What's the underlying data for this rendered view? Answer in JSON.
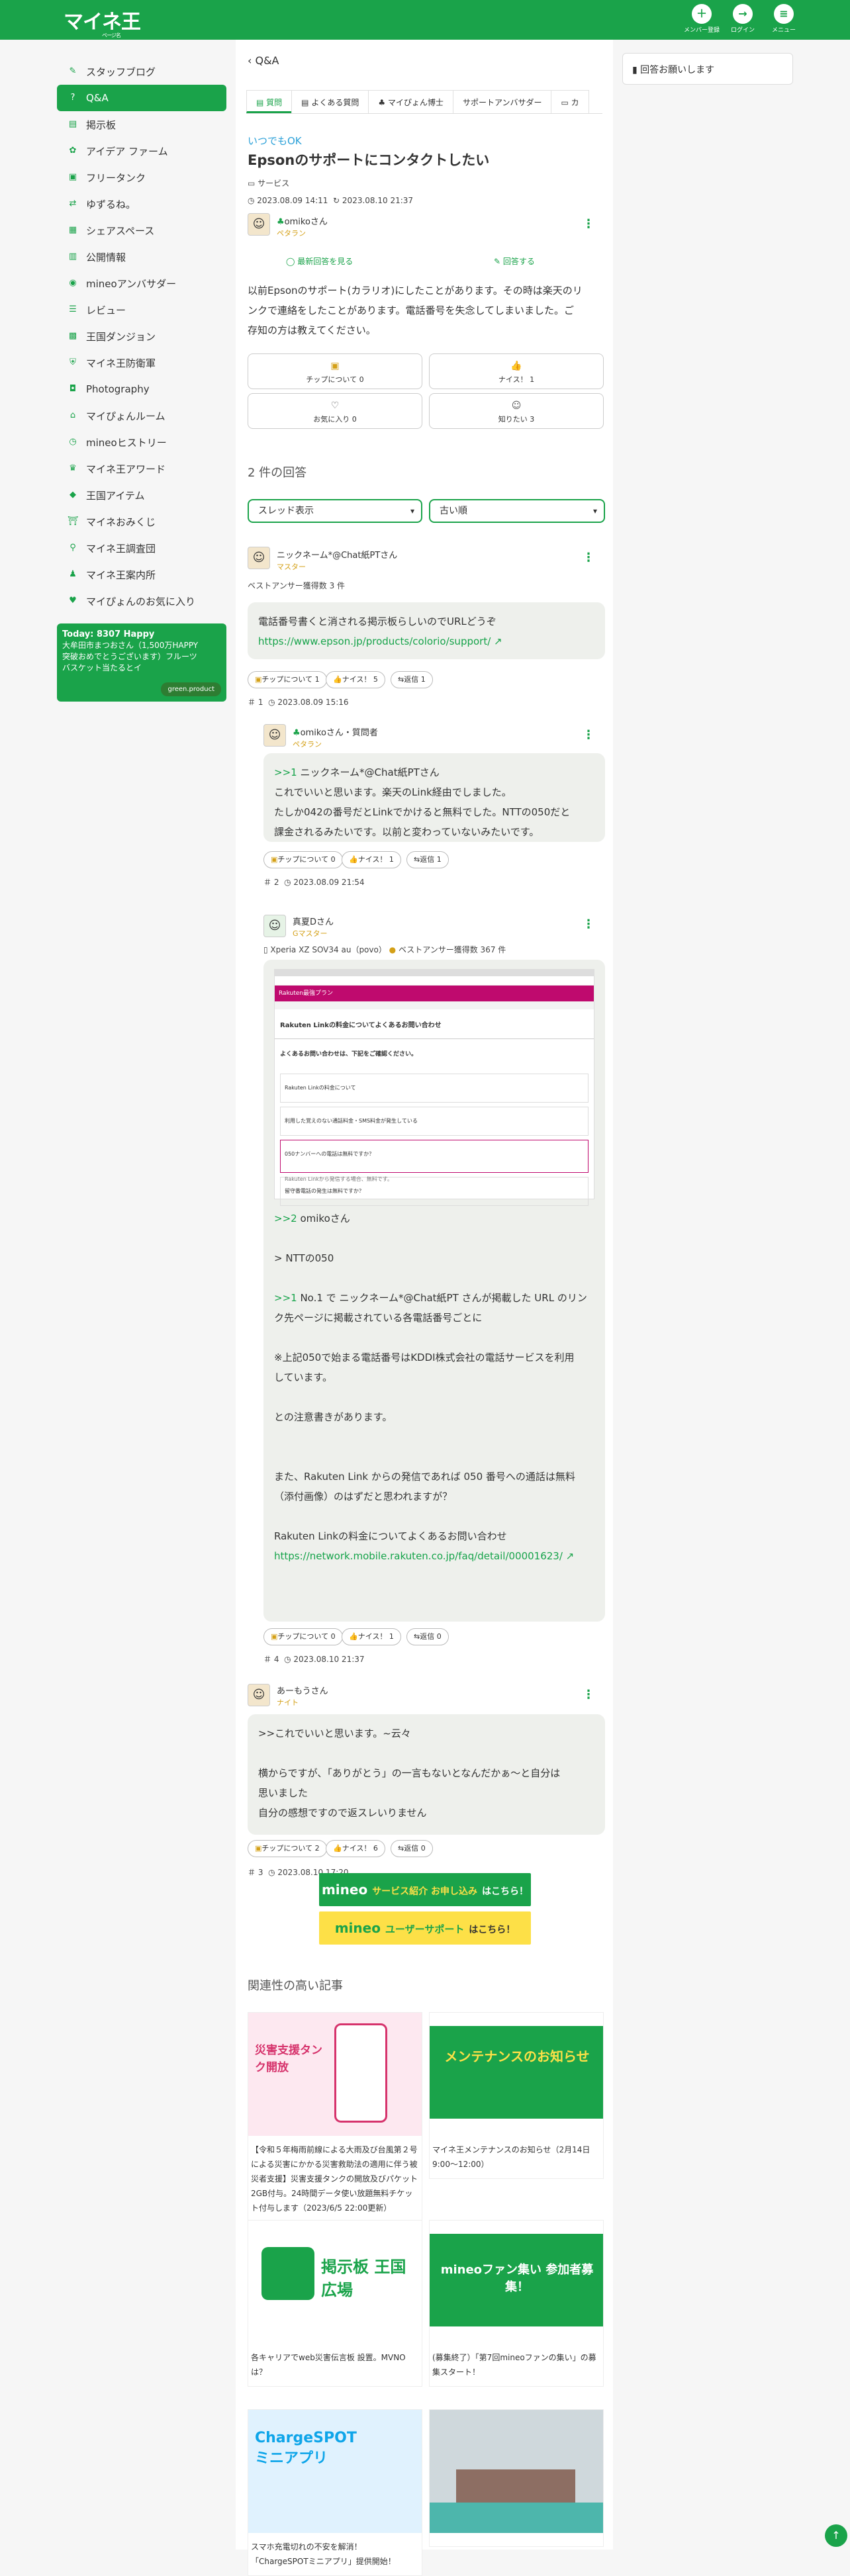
{
  "header": {
    "logo": "マイネ王",
    "logo_sub": "ページ名",
    "member_label": "メンバー登録",
    "login_label": "ログイン",
    "menu_label": "メニュー"
  },
  "sidebar": {
    "items": [
      {
        "label": "スタッフブログ",
        "icon": "blog-icon"
      },
      {
        "label": "Q&A",
        "icon": "qa-icon"
      },
      {
        "label": "掲示板",
        "icon": "board-icon"
      },
      {
        "label": "アイデア ファーム",
        "icon": "idea-icon"
      },
      {
        "label": "フリータンク",
        "icon": "tank-icon"
      },
      {
        "label": "ゆずるね。",
        "icon": "yuzurune-icon"
      },
      {
        "label": "シェアスペース",
        "icon": "share-icon"
      },
      {
        "label": "公開情報",
        "icon": "public-icon"
      },
      {
        "label": "mineoアンバサダー",
        "icon": "ambassador-icon"
      },
      {
        "label": "レビュー",
        "icon": "review-icon"
      },
      {
        "label": "王国ダンジョン",
        "icon": "dungeon-icon"
      },
      {
        "label": "マイネ王防衛軍",
        "icon": "defense-icon"
      },
      {
        "label": "Photography",
        "icon": "camera-icon"
      },
      {
        "label": "マイぴょんルーム",
        "icon": "room-icon"
      },
      {
        "label": "mineoヒストリー",
        "icon": "history-icon"
      },
      {
        "label": "マイネ王アワード",
        "icon": "award-icon"
      },
      {
        "label": "王国アイテム",
        "icon": "item-icon"
      },
      {
        "label": "マイネおみくじ",
        "icon": "omikuji-icon"
      },
      {
        "label": "マイネ王調査団",
        "icon": "survey-icon"
      },
      {
        "label": "マイネ王案内所",
        "icon": "guide-icon"
      },
      {
        "label": "マイぴょんのお気に入り",
        "icon": "favorite-icon"
      }
    ],
    "promo": {
      "title": "Today: 8307 Happy",
      "line1": "大牟田市まつおさん（1,500万HAPPY",
      "line2": "突破おめでとうございます）フルーツ",
      "line3": "バスケット当たるとイ",
      "badge": "green.product"
    }
  },
  "right": {
    "notice": "回答お願いします"
  },
  "main": {
    "crumb": "Q&A",
    "tabs": [
      "質問",
      "よくある質問",
      "マイぴょん博士",
      "サポートアンバサダー",
      "カ"
    ],
    "question": {
      "tag": "いつでもOK",
      "title": "Epsonのサポートにコンタクトしたい",
      "category": "サービス",
      "posted": "2023.08.09 14:11",
      "updated": "2023.08.10 21:37",
      "user": "omikoさん",
      "level": "ペタラン",
      "view_latest": "最新回答を見る",
      "reply": "回答する",
      "body1": "以前Epsonのサポート(カラリオ)にしたことがあります。その時は楽天のリ",
      "body2": "ンクで連絡をしたことがあります。電話番号を失念してしまいました。ご",
      "body3": "存知の方は教えてください。",
      "chip_label": "チップについて 0",
      "nice_label": "ナイス！ 1",
      "fav_label": "お気に入り 0",
      "know_label": "知りたい 3"
    },
    "answers_count": "2 件の回答",
    "thread_select": "スレッド表示",
    "order_select": "古い順",
    "a1": {
      "user": "ニックネーム*@Chat紙PTさん",
      "level": "マスター",
      "best": "ベストアンサー獲得数 3 件",
      "text1": "電話番号書くと消される掲示板らしいのでURLどうぞ",
      "url": "https://www.epson.jp/products/colorio/support/",
      "chip": "チップについて 1",
      "nice": "ナイス！ 5",
      "reply": "返信 1",
      "num": "1",
      "date": "2023.08.09 15:16"
    },
    "r1": {
      "user": "omikoさん・質問者",
      "level": "ペタラン",
      "ref": ">>1",
      "ref_user": "ニックネーム*@Chat紙PTさん",
      "l1": "これでいいと思います。楽天のLink経由でしました。",
      "l2": "たしか042の番号だとLinkでかけると無料でした。NTTの050だと",
      "l3": "課金されるみたいです。以前と変わっていないみたいです。",
      "chip": "チップについて 0",
      "nice": "ナイス！ 1",
      "reply": "返信 1",
      "num": "2",
      "date": "2023.08.09 21:54"
    },
    "r2": {
      "user": "真夏Dさん",
      "level": "Gマスター",
      "device": "Xperia XZ SOV34 au（povo）",
      "best": "ベストアンサー獲得数 367 件",
      "ref": ">>2",
      "ref_user": "omikoさん",
      "l1": "> NTTの050",
      "ref2": ">>1",
      "l2": " No.1 で ニックネーム*@Chat紙PT さんが掲載した URL のリン",
      "l3": "ク先ページに掲載されている各電話番号ごとに",
      "l4": "※上記050で始まる電話番号はKDDI株式会社の電話サービスを利用",
      "l5": "しています。",
      "l6": "との注意書きがあります。",
      "l7": "また、Rakuten Link からの発信であれば 050 番号への通話は無料",
      "l8": "（添付画像）のはずだと思われますが？",
      "l9": "Rakuten Linkの料金についてよくあるお問い合わせ",
      "url": "https://network.mobile.rakuten.co.jp/faq/detail/00001623/",
      "chip": "チップについて 0",
      "nice": "ナイス！ 1",
      "reply": "返信 0",
      "num": "4",
      "date": "2023.08.10 21:37",
      "shot": {
        "title": "Rakuten Linkの料金についてよくあるお問い合わせ",
        "sub": "よくあるお問い合わせは、下記をご確認ください。",
        "q1": "Rakuten Linkの料金について",
        "q2": "利用した覚えのない通話料金・SMS料金が発生している",
        "q3": "050ナンバーへの電話は無料ですか？",
        "q3a": "Rakuten Linkから発信する場合、無料です。",
        "q4": "留守番電話の発生は無料ですか？",
        "brand": "Rakuten最強プラン"
      }
    },
    "a2": {
      "user": "あーもうさん",
      "level": "ナイト",
      "l1": ">>これでいいと思います。~云々",
      "l2": "横からですが、「ありがとう」の一言もないとなんだかぁ～と自分は",
      "l3": "思いました",
      "l4": "自分の感想ですので返スレいりません",
      "chip": "チップについて 2",
      "nice": "ナイス！ 6",
      "reply": "返信 0",
      "num": "3",
      "date": "2023.08.10 17:20"
    },
    "banner1": {
      "brand": "mineo",
      "text": "サービス紹介 お申し込み",
      "cta": "はこちら！"
    },
    "banner2": {
      "brand": "mineo",
      "text": "ユーザーサポート",
      "cta": "はこちら！"
    },
    "related_title": "関連性の高い記事",
    "cards": [
      {
        "img_title": "災害支援タンク開放",
        "txt": "【令和５年梅雨前線による大雨及び台風第２号による災害にかかる災害救助法の適用に伴う被災者支援】災害支援タンクの開放及びパケット2GB付与。24時間データ使い放題無料チケット付与します（2023/6/5 22:00更新）"
      },
      {
        "img_title": "メンテナンスのお知らせ",
        "txt": "マイネ王メンテナンスのお知らせ（2月14日 9:00〜12:00）"
      },
      {
        "img_title": "掲示板 王国広場",
        "txt": "各キャリアでweb災害伝言板 設置。MVNOは？"
      },
      {
        "img_title": "mineoファン集い 参加者募集！",
        "txt": "(募集終了）「第7回mineoファンの集い」の募集スタート！"
      },
      {
        "img_title": "ChargeSPOT ミニアプリ",
        "txt": "スマホ充電切れの不安を解消！「ChargeSPOTミニアプリ」提供開始！"
      },
      {
        "img_title": "",
        "txt": ""
      }
    ]
  },
  "colors": {
    "brand": "#1aa34a",
    "accent": "#d4a017"
  }
}
